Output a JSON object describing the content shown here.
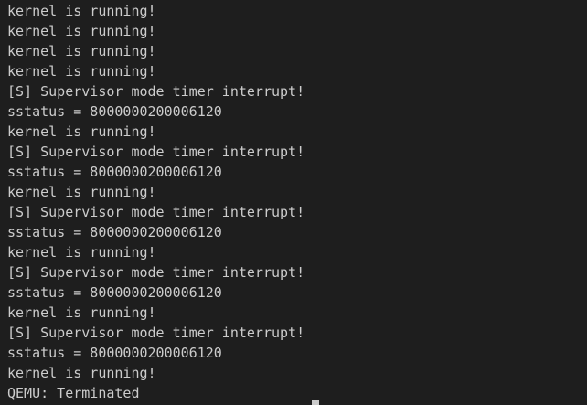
{
  "terminal": {
    "lines": [
      "kernel is running!",
      "kernel is running!",
      "kernel is running!",
      "kernel is running!",
      "[S] Supervisor mode timer interrupt!",
      "sstatus = 8000000200006120",
      "kernel is running!",
      "[S] Supervisor mode timer interrupt!",
      "sstatus = 8000000200006120",
      "kernel is running!",
      "[S] Supervisor mode timer interrupt!",
      "sstatus = 8000000200006120",
      "kernel is running!",
      "[S] Supervisor mode timer interrupt!",
      "sstatus = 8000000200006120",
      "kernel is running!",
      "[S] Supervisor mode timer interrupt!",
      "sstatus = 8000000200006120",
      "kernel is running!",
      "QEMU: Terminated"
    ],
    "colors": {
      "background": "#1e1e1e",
      "foreground": "#cccccc"
    }
  }
}
